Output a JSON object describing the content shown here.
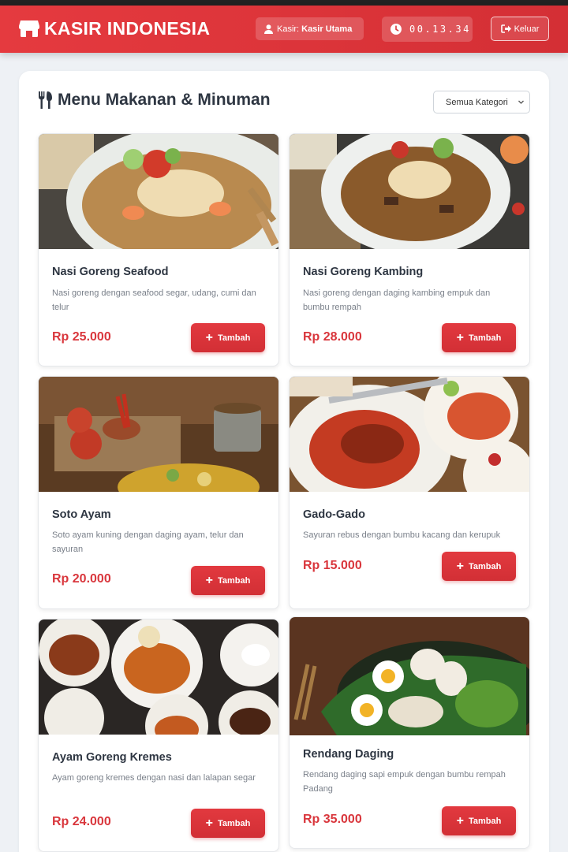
{
  "header": {
    "brand_title": "KASIR INDONESIA",
    "cashier_label": "Kasir:",
    "cashier_name": "Kasir Utama",
    "clock": "00.13.34",
    "logout_label": "Keluar"
  },
  "menu": {
    "title": "Menu Makanan & Minuman",
    "category_select": "Semua Kategori",
    "add_label": "Tambah",
    "items": [
      {
        "name": "Nasi Goreng Seafood",
        "description": "Nasi goreng dengan seafood segar, udang, cumi dan telur",
        "price": "Rp 25.000"
      },
      {
        "name": "Nasi Goreng Kambing",
        "description": "Nasi goreng dengan daging kambing empuk dan bumbu rempah",
        "price": "Rp 28.000"
      },
      {
        "name": "Soto Ayam",
        "description": "Soto ayam kuning dengan daging ayam, telur dan sayuran",
        "price": "Rp 20.000"
      },
      {
        "name": "Gado-Gado",
        "description": "Sayuran rebus dengan bumbu kacang dan kerupuk",
        "price": "Rp 15.000"
      },
      {
        "name": "Ayam Goreng Kremes",
        "description": "Ayam goreng kremes dengan nasi dan lalapan segar",
        "price": "Rp 24.000"
      },
      {
        "name": "Rendang Daging",
        "description": "Rendang daging sapi empuk dengan bumbu rempah Padang",
        "price": "Rp 35.000"
      }
    ]
  },
  "colors": {
    "accent": "#d9363c",
    "header": "#e53a3f",
    "text_dark": "#2e3642",
    "text_muted": "#7a808a"
  },
  "icons": {
    "brand": "store-icon",
    "user": "user-icon",
    "clock": "clock-icon",
    "logout": "sign-out-icon",
    "menu": "utensils-icon",
    "add": "plus-icon"
  }
}
